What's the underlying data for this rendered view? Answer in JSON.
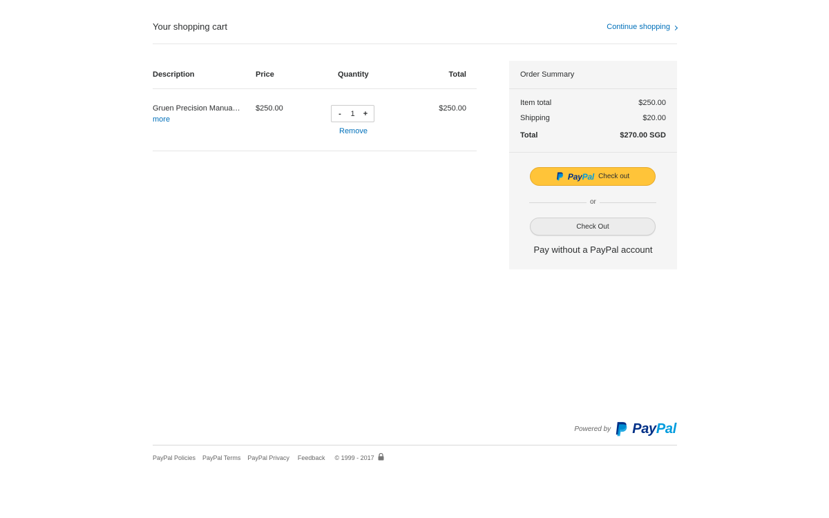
{
  "header": {
    "title": "Your shopping cart",
    "continue_label": "Continue shopping"
  },
  "cart": {
    "columns": {
      "description": "Description",
      "price": "Price",
      "quantity": "Quantity",
      "total": "Total"
    },
    "item": {
      "name": "Gruen Precision Manual ...",
      "more_label": "more",
      "price": "$250.00",
      "quantity": "1",
      "total": "$250.00",
      "remove_label": "Remove",
      "decrement": "-",
      "increment": "+"
    }
  },
  "summary": {
    "title": "Order Summary",
    "item_total_label": "Item total",
    "item_total_value": "$250.00",
    "shipping_label": "Shipping",
    "shipping_value": "$20.00",
    "total_label": "Total",
    "total_value": "$270.00 SGD",
    "paypal_pay": "Pay",
    "paypal_pal": "Pal",
    "paypal_checkout_label": "Check out",
    "or_label": "or",
    "checkout_label": "Check Out",
    "pay_without_label": "Pay without a PayPal account"
  },
  "footer": {
    "powered_by": "Powered by",
    "logo_pay": "Pay",
    "logo_pal": "Pal",
    "links": [
      "PayPal Policies",
      "PayPal Terms",
      "PayPal Privacy",
      "Feedback"
    ],
    "copyright": "© 1999 - 2017"
  },
  "colors": {
    "link": "#0070ba",
    "paypal_button": "#ffc439",
    "paypal_dark_blue": "#003087",
    "paypal_light_blue": "#009cde",
    "summary_background": "#f5f5f5"
  },
  "icons": {
    "continue": "chevron-right-icon",
    "paypal_mark": "paypal-p-icon",
    "secure": "lock-icon"
  }
}
